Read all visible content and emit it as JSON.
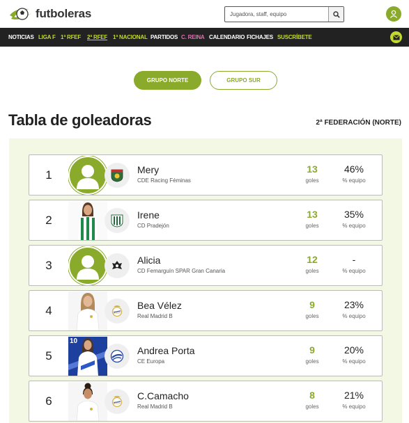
{
  "brand": {
    "name": "futboleras",
    "accent": "#8aaa2b"
  },
  "search": {
    "placeholder": "Jugadora, staff, equipo",
    "icon": "search-icon"
  },
  "nav": [
    {
      "label": "NOTICIAS",
      "color": "#ffffff"
    },
    {
      "label": "LIGA F",
      "color": "#c4d930"
    },
    {
      "label": "1ª RFEF",
      "color": "#c4d930"
    },
    {
      "label": "2ª RFEF",
      "color": "#c4d930",
      "active": true
    },
    {
      "label": "1ª NACIONAL",
      "color": "#c4d930"
    },
    {
      "label": "PARTIDOS",
      "color": "#ffffff"
    },
    {
      "label": "C. REINA",
      "color": "#e070b0"
    },
    {
      "label": "CALENDARIO",
      "color": "#ffffff"
    },
    {
      "label": "FICHAJES",
      "color": "#ffffff"
    },
    {
      "label": "SUSCRÍBETE",
      "color": "#c4d930"
    }
  ],
  "groups": {
    "active": "GRUPO NORTE",
    "inactive": "GRUPO SUR"
  },
  "page": {
    "title": "Tabla de goleadoras",
    "competition": "2ª FEDERACIÓN (NORTE)"
  },
  "labels": {
    "goals": "goles",
    "team_pct": "% equipo"
  },
  "players": [
    {
      "rank": "1",
      "name": "Mery",
      "club": "CDE Racing Féminas",
      "goals": "13",
      "pct": "46%",
      "photo": "placeholder"
    },
    {
      "rank": "2",
      "name": "Irene",
      "club": "CD Pradejón",
      "goals": "13",
      "pct": "35%",
      "photo": "photo-green-kit"
    },
    {
      "rank": "3",
      "name": "Alicia",
      "club": "CD Femarguín SPAR Gran Canaria",
      "goals": "12",
      "pct": "-",
      "photo": "placeholder"
    },
    {
      "rank": "4",
      "name": "Bea Vélez",
      "club": "Real Madrid B",
      "goals": "9",
      "pct": "23%",
      "photo": "photo-white-kit"
    },
    {
      "rank": "5",
      "name": "Andrea Porta",
      "club": "CE Europa",
      "goals": "9",
      "pct": "20%",
      "photo": "photo-blue-kit",
      "shirt_number": "10"
    },
    {
      "rank": "6",
      "name": "C.Camacho",
      "club": "Real Madrid B",
      "goals": "8",
      "pct": "21%",
      "photo": "photo-white-kit"
    }
  ]
}
